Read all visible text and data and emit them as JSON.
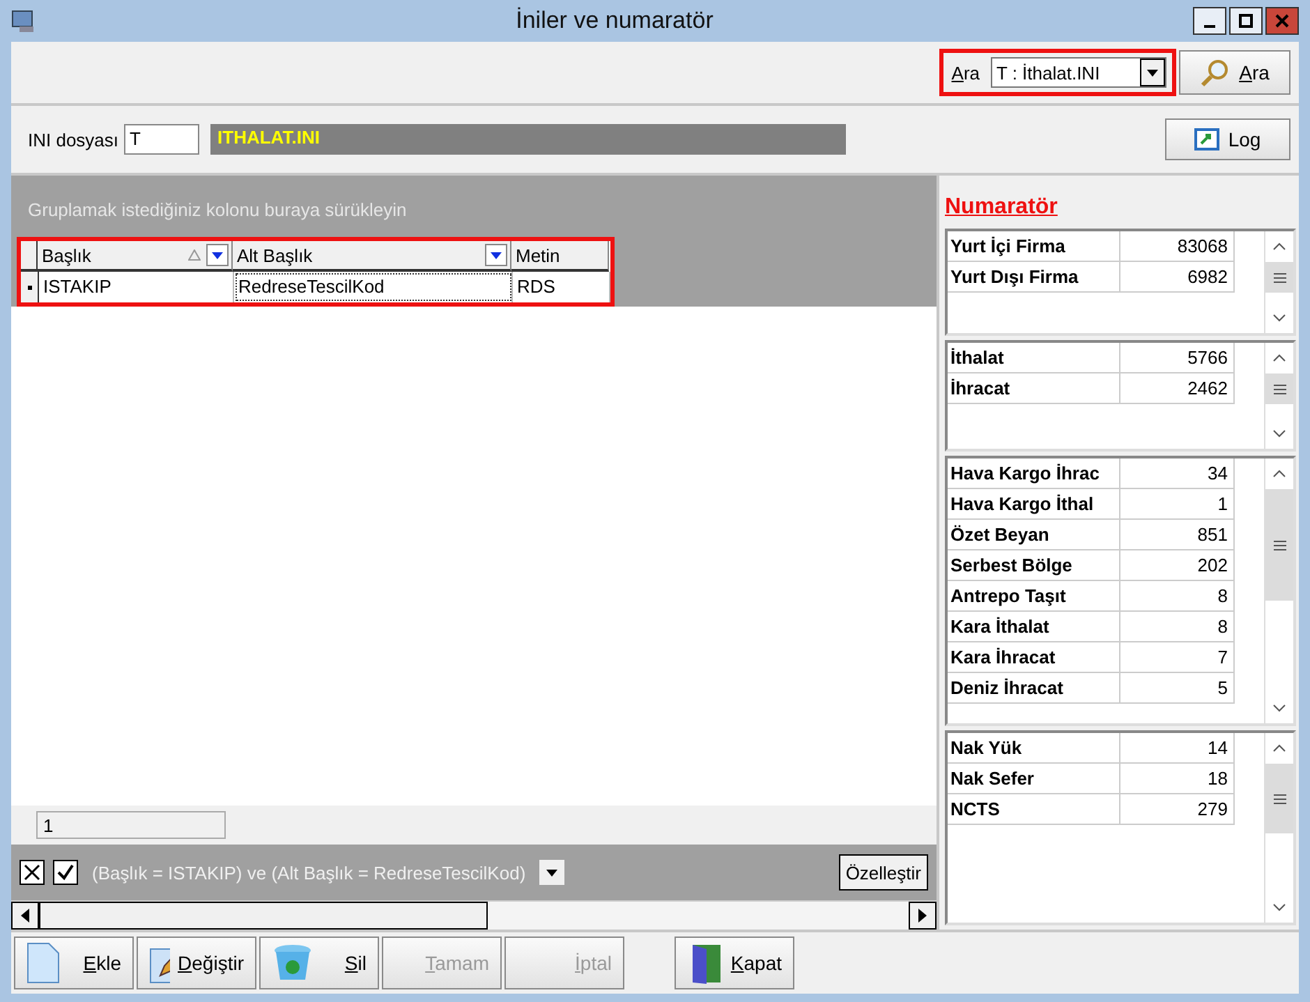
{
  "window": {
    "title": "İniler ve numaratör"
  },
  "search": {
    "label": "Ara",
    "value": "T : İthalat.INI",
    "button": "Ara",
    "highlighted": true
  },
  "ini_file": {
    "label": "INI dosyası",
    "code": "T",
    "name": "ITHALAT.INI"
  },
  "log_button": "Log",
  "grid": {
    "group_hint": "Gruplamak istediğiniz kolonu buraya sürükleyin",
    "highlighted": true,
    "columns": [
      {
        "label": "Başlık",
        "sorted": true,
        "filter": true
      },
      {
        "label": "Alt Başlık",
        "sorted": false,
        "filter": true
      },
      {
        "label": "Metin",
        "sorted": false,
        "filter": false
      }
    ],
    "rows": [
      {
        "cells": [
          "ISTAKIP",
          "RedreseTescilKod",
          "RDS"
        ],
        "selected": true
      }
    ],
    "footer": "1",
    "filter": {
      "enabled": true,
      "text": "(Başlık = ISTAKIP) ve (Alt Başlık = RedreseTescilKod)",
      "button": "Özelleştir"
    }
  },
  "numerator": {
    "title": "Numaratör",
    "groups": [
      {
        "rows": [
          {
            "label": "Yurt İçi Firma",
            "value": "83068"
          },
          {
            "label": "Yurt Dışı Firma",
            "value": "6982"
          }
        ]
      },
      {
        "rows": [
          {
            "label": "İthalat",
            "value": "5766"
          },
          {
            "label": "İhracat",
            "value": "2462"
          }
        ]
      },
      {
        "rows": [
          {
            "label": "Hava Kargo İhrac",
            "value": "34"
          },
          {
            "label": "Hava Kargo İthal",
            "value": "1"
          },
          {
            "label": "Özet Beyan",
            "value": "851"
          },
          {
            "label": "Serbest Bölge",
            "value": "202"
          },
          {
            "label": "Antrepo Taşıt",
            "value": "8"
          },
          {
            "label": "Kara İthalat",
            "value": "8"
          },
          {
            "label": "Kara İhracat",
            "value": "7"
          },
          {
            "label": "Deniz İhracat",
            "value": "5"
          }
        ]
      },
      {
        "rows": [
          {
            "label": "Nak Yük",
            "value": "14"
          },
          {
            "label": "Nak Sefer",
            "value": "18"
          },
          {
            "label": "NCTS",
            "value": "279"
          }
        ]
      }
    ]
  },
  "buttons": [
    {
      "label": "Ekle",
      "kind": "page",
      "disabled": false
    },
    {
      "label": "Değiştir",
      "kind": "pencil",
      "disabled": false
    },
    {
      "label": "Sil",
      "kind": "bin",
      "disabled": false
    },
    {
      "label": "Tamam",
      "kind": "plain",
      "disabled": true
    },
    {
      "label": "İptal",
      "kind": "plain",
      "disabled": true
    },
    {
      "label": "Kapat",
      "kind": "door",
      "disabled": false
    }
  ]
}
